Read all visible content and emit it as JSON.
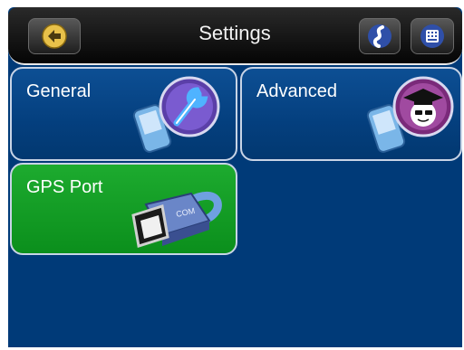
{
  "header": {
    "title": "Settings",
    "back_icon": "back-arrow-icon",
    "right_icons": [
      "route-icon",
      "keyboard-icon"
    ]
  },
  "tiles": [
    {
      "label": "General",
      "icon": "wrench-icon",
      "color": "#0a4a8c"
    },
    {
      "label": "Advanced",
      "icon": "graduate-icon",
      "color": "#0a4a8c"
    },
    {
      "label": "GPS Port",
      "icon": "com-port-icon",
      "color": "#13a025"
    }
  ],
  "colors": {
    "background": "#003a78",
    "accent_green": "#13a025",
    "header": "#111111"
  }
}
